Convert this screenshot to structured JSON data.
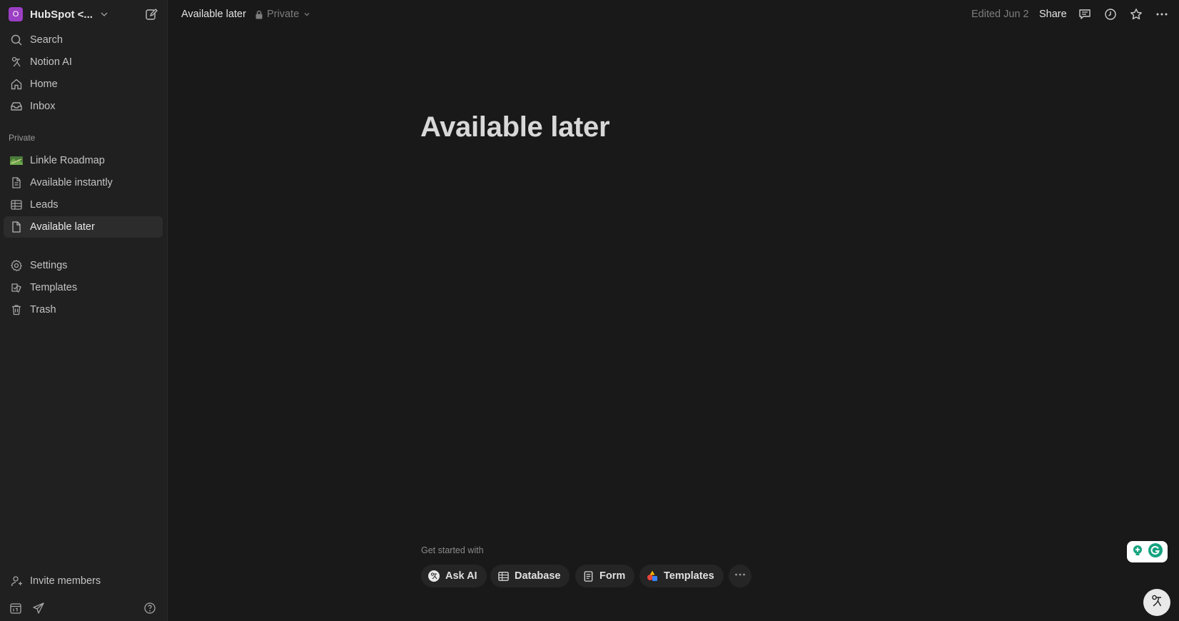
{
  "workspace": {
    "avatar_letter": "O",
    "name": "HubSpot <...",
    "avatar_color": "#9b3fc4"
  },
  "sidebar": {
    "top_items": [
      {
        "label": "Search",
        "icon": "search-icon"
      },
      {
        "label": "Notion AI",
        "icon": "notion-ai-icon"
      },
      {
        "label": "Home",
        "icon": "home-icon"
      },
      {
        "label": "Inbox",
        "icon": "inbox-icon"
      }
    ],
    "section_label": "Private",
    "pages": [
      {
        "label": "Linkle Roadmap",
        "icon": "roadmap-image-icon"
      },
      {
        "label": "Available instantly",
        "icon": "page-icon"
      },
      {
        "label": "Leads",
        "icon": "table-icon"
      },
      {
        "label": "Available later",
        "icon": "page-icon",
        "active": true
      }
    ],
    "utility_items": [
      {
        "label": "Settings",
        "icon": "gear-icon"
      },
      {
        "label": "Templates",
        "icon": "templates-icon"
      },
      {
        "label": "Trash",
        "icon": "trash-icon"
      }
    ],
    "invite_label": "Invite members"
  },
  "topbar": {
    "breadcrumb_title": "Available later",
    "privacy_label": "Private",
    "edited_label": "Edited Jun 2",
    "share_label": "Share"
  },
  "page": {
    "title": "Available later",
    "get_started_label": "Get started with",
    "chips": [
      {
        "label": "Ask AI",
        "icon": "ai-face-icon"
      },
      {
        "label": "Database",
        "icon": "table-icon"
      },
      {
        "label": "Form",
        "icon": "form-icon"
      },
      {
        "label": "Templates",
        "icon": "templates-color-icon"
      }
    ]
  },
  "colors": {
    "background": "#191919",
    "sidebar": "#202020",
    "active_item": "#2c2c2c"
  }
}
